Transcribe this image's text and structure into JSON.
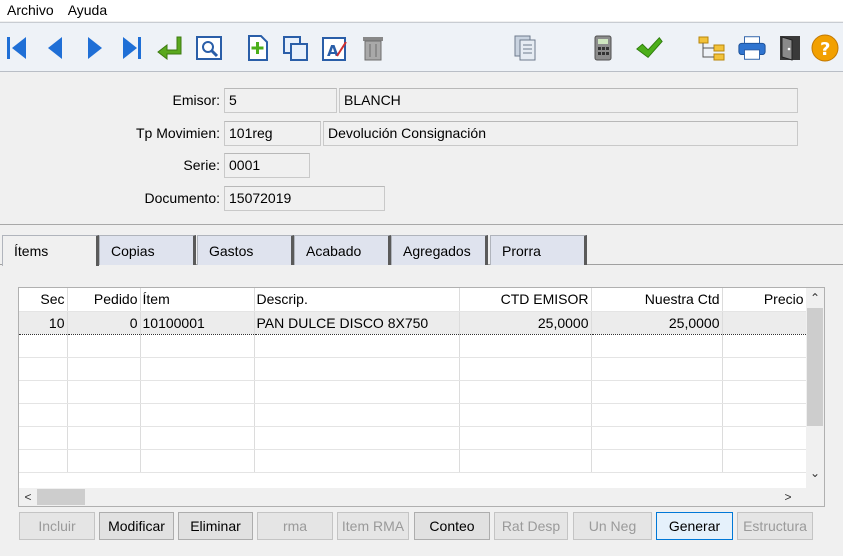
{
  "menu": [
    "Archivo",
    "Ayuda"
  ],
  "toolbar": {
    "icons": [
      "first-record-icon",
      "prev-record-icon",
      "next-record-icon",
      "last-record-icon",
      "enter-icon",
      "preview-icon",
      "new-document-icon",
      "copy-icon",
      "text-edit-icon",
      "trash-icon",
      "report-icon",
      "calculator-icon",
      "checkmark-icon",
      "tree-structure-icon",
      "printer-icon",
      "exit-door-icon",
      "help-icon"
    ]
  },
  "form": {
    "emisor_label": "Emisor:",
    "emisor_code": "5",
    "emisor_name": "BLANCH",
    "tp_label": "Tp Movimien:",
    "tp_code": "101reg",
    "tp_name": "Devolución Consignación",
    "serie_label": "Serie:",
    "serie_value": "0001",
    "doc_label": "Documento:",
    "doc_value": "15072019"
  },
  "tabs": [
    "Ítems",
    "Copias",
    "Gastos",
    "Acabado",
    "Agregados",
    "Prorra"
  ],
  "grid": {
    "columns": [
      "Sec",
      "Pedido",
      "Ítem",
      "Descrip.",
      "CTD EMISOR",
      "Nuestra Ctd",
      "Precio"
    ],
    "rows": [
      [
        "10",
        "0",
        "10100001",
        "PAN DULCE DISCO 8X750",
        "25,0000",
        "25,0000",
        ""
      ]
    ]
  },
  "buttons": [
    {
      "label": "Incluir",
      "enabled": false
    },
    {
      "label": "Modificar",
      "enabled": true
    },
    {
      "label": "Eliminar",
      "enabled": true
    },
    {
      "label": "rma",
      "enabled": false
    },
    {
      "label": "Item RMA",
      "enabled": false
    },
    {
      "label": "Conteo",
      "enabled": true
    },
    {
      "label": "Rat Desp",
      "enabled": false
    },
    {
      "label": "Un Neg",
      "enabled": false
    },
    {
      "label": "Generar",
      "enabled": true
    },
    {
      "label": "Estructura",
      "enabled": false
    }
  ]
}
